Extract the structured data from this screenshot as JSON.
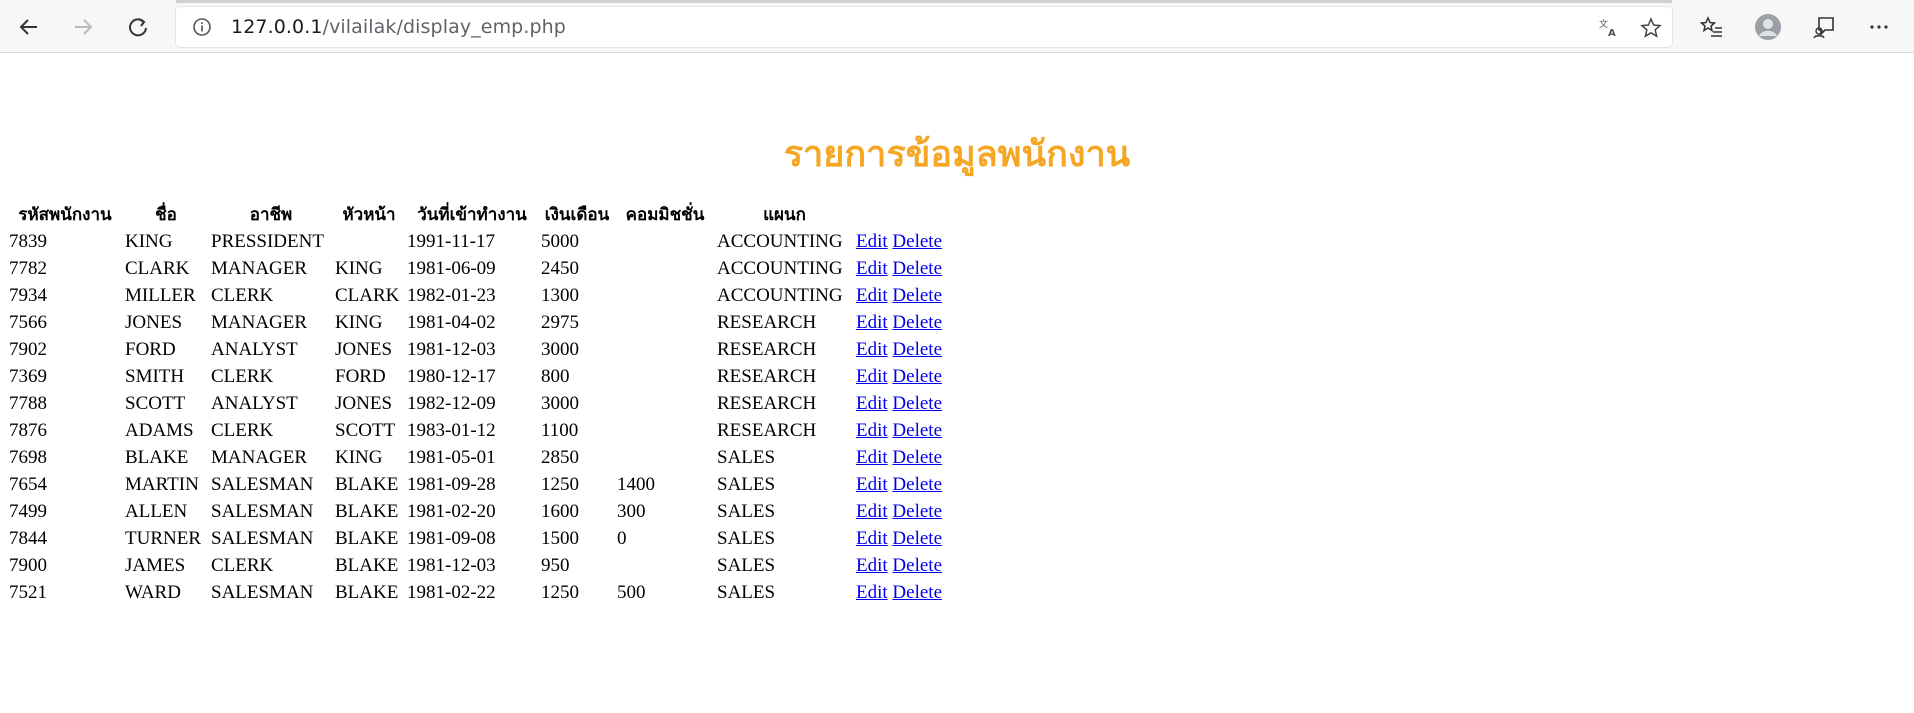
{
  "browser": {
    "url_host": "127.0.0.1",
    "url_path": "/vilailak/display_emp.php",
    "icons": {
      "back": "back-arrow-icon",
      "forward": "forward-arrow-icon",
      "refresh": "refresh-icon",
      "info": "info-icon",
      "translate": "translate-icon",
      "favorite": "star-icon",
      "favorites": "favorites-list-icon",
      "profile": "profile-avatar-icon",
      "feedback": "feedback-icon",
      "more": "more-icon"
    }
  },
  "page": {
    "title": "รายการข้อมูลพนักงาน",
    "title_color": "#f5a623"
  },
  "table": {
    "headers": [
      "รหัสพนักงาน",
      "ชื่อ",
      "อาชีพ",
      "หัวหน้า",
      "วันที่เข้าทำงาน",
      "เงินเดือน",
      "คอมมิชชั่น",
      "แผนก"
    ],
    "edit_label": "Edit",
    "delete_label": "Delete",
    "rows": [
      [
        "7839",
        "KING",
        "PRESSIDENT",
        "",
        "1991-11-17",
        "5000",
        "",
        "ACCOUNTING"
      ],
      [
        "7782",
        "CLARK",
        "MANAGER",
        "KING",
        "1981-06-09",
        "2450",
        "",
        "ACCOUNTING"
      ],
      [
        "7934",
        "MILLER",
        "CLERK",
        "CLARK",
        "1982-01-23",
        "1300",
        "",
        "ACCOUNTING"
      ],
      [
        "7566",
        "JONES",
        "MANAGER",
        "KING",
        "1981-04-02",
        "2975",
        "",
        "RESEARCH"
      ],
      [
        "7902",
        "FORD",
        "ANALYST",
        "JONES",
        "1981-12-03",
        "3000",
        "",
        "RESEARCH"
      ],
      [
        "7369",
        "SMITH",
        "CLERK",
        "FORD",
        "1980-12-17",
        "800",
        "",
        "RESEARCH"
      ],
      [
        "7788",
        "SCOTT",
        "ANALYST",
        "JONES",
        "1982-12-09",
        "3000",
        "",
        "RESEARCH"
      ],
      [
        "7876",
        "ADAMS",
        "CLERK",
        "SCOTT",
        "1983-01-12",
        "1100",
        "",
        "RESEARCH"
      ],
      [
        "7698",
        "BLAKE",
        "MANAGER",
        "KING",
        "1981-05-01",
        "2850",
        "",
        "SALES"
      ],
      [
        "7654",
        "MARTIN",
        "SALESMAN",
        "BLAKE",
        "1981-09-28",
        "1250",
        "1400",
        "SALES"
      ],
      [
        "7499",
        "ALLEN",
        "SALESMAN",
        "BLAKE",
        "1981-02-20",
        "1600",
        "300",
        "SALES"
      ],
      [
        "7844",
        "TURNER",
        "SALESMAN",
        "BLAKE",
        "1981-09-08",
        "1500",
        "0",
        "SALES"
      ],
      [
        "7900",
        "JAMES",
        "CLERK",
        "BLAKE",
        "1981-12-03",
        "950",
        "",
        "SALES"
      ],
      [
        "7521",
        "WARD",
        "SALESMAN",
        "BLAKE",
        "1981-02-22",
        "1250",
        "500",
        "SALES"
      ]
    ]
  }
}
